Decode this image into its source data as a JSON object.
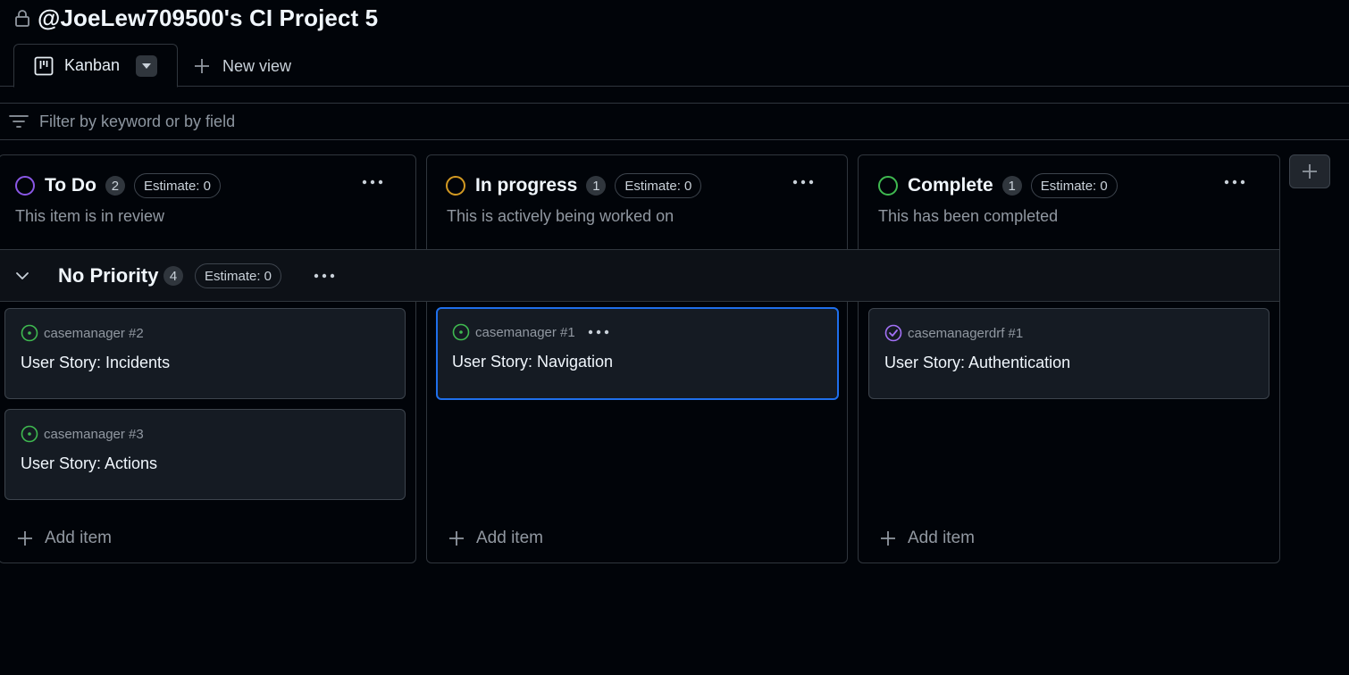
{
  "header": {
    "title": "@JoeLew709500's CI Project 5"
  },
  "tabs": {
    "active_label": "Kanban",
    "new_view_label": "New view"
  },
  "filter": {
    "placeholder": "Filter by keyword or by field"
  },
  "columns": [
    {
      "name": "To Do",
      "count": "2",
      "estimate": "Estimate: 0",
      "description": "This item is in review",
      "status_color": "#8957e5"
    },
    {
      "name": "In progress",
      "count": "1",
      "estimate": "Estimate: 0",
      "description": "This is actively being worked on",
      "status_color": "#d29922"
    },
    {
      "name": "Complete",
      "count": "1",
      "estimate": "Estimate: 0",
      "description": "This has been completed",
      "status_color": "#3fb950"
    }
  ],
  "group": {
    "name": "No Priority",
    "count": "4",
    "estimate": "Estimate: 0"
  },
  "cards": [
    {
      "repo": "casemanager #2",
      "title": "User Story: Incidents",
      "state": "open"
    },
    {
      "repo": "casemanager #3",
      "title": "User Story: Actions",
      "state": "open"
    },
    {
      "repo": "casemanager #1",
      "title": "User Story: Navigation",
      "state": "open",
      "selected": true
    },
    {
      "repo": "casemanagerdrf #1",
      "title": "User Story: Authentication",
      "state": "closed"
    }
  ],
  "add_item_label": "Add item",
  "colors": {
    "open": "#3fb950",
    "closed": "#a371f7",
    "accent": "#1f6feb"
  }
}
